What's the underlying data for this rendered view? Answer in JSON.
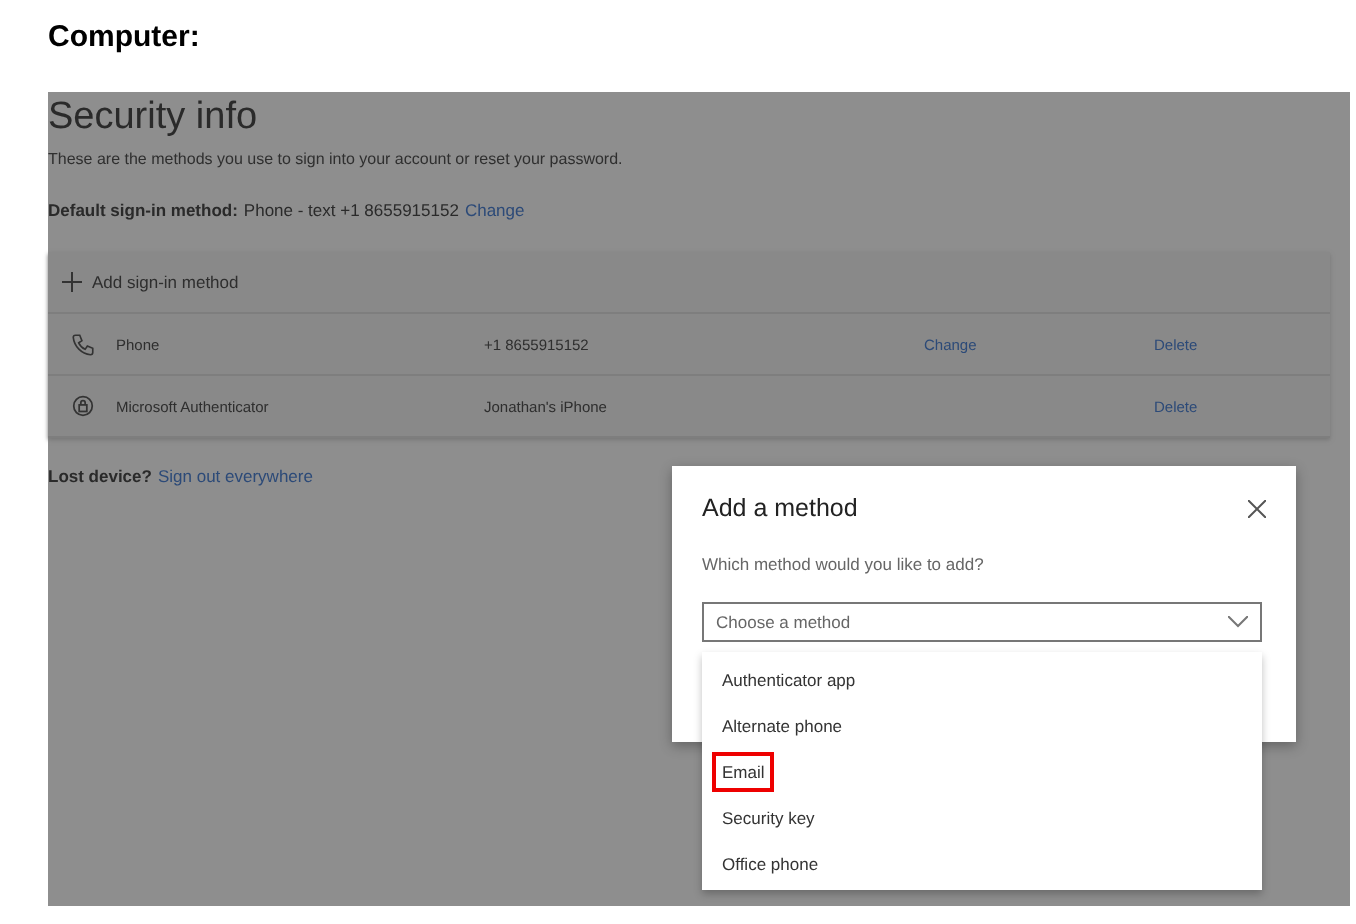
{
  "heading": "Computer:",
  "page": {
    "title": "Security info",
    "description": "These are the methods you use to sign into your account or reset your password.",
    "default_method": {
      "label": "Default sign-in method:",
      "value": "Phone - text +1 8655915152",
      "link": "Change"
    },
    "add_method": "Add sign-in method",
    "methods": [
      {
        "kind": "phone",
        "name": "Phone",
        "detail": "+1 8655915152",
        "change": "Change",
        "delete": "Delete"
      },
      {
        "kind": "authenticator",
        "name": "Microsoft Authenticator",
        "detail": "Jonathan's iPhone",
        "delete": "Delete"
      }
    ],
    "lost_device": {
      "label": "Lost device?",
      "link": "Sign out everywhere"
    }
  },
  "dialog": {
    "title": "Add a method",
    "question": "Which method would you like to add?",
    "placeholder": "Choose a method",
    "options": [
      {
        "label": "Authenticator app",
        "highlighted": false
      },
      {
        "label": "Alternate phone",
        "highlighted": false
      },
      {
        "label": "Email",
        "highlighted": true
      },
      {
        "label": "Security key",
        "highlighted": false
      },
      {
        "label": "Office phone",
        "highlighted": false
      }
    ]
  }
}
